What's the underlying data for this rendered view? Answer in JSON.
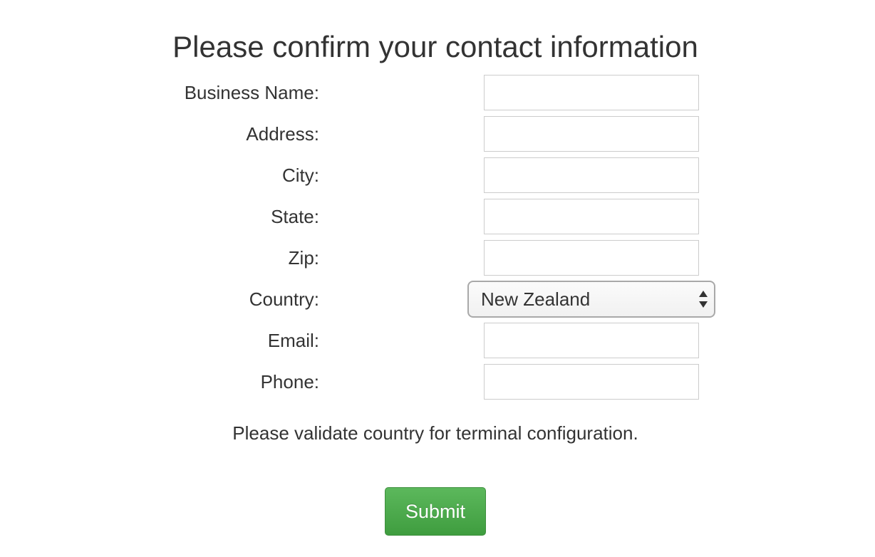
{
  "page": {
    "title": "Please confirm your contact information"
  },
  "form": {
    "fields": [
      {
        "label": "Business Name:",
        "value": "",
        "placeholder": ""
      },
      {
        "label": "Address:",
        "value": "",
        "placeholder": ""
      },
      {
        "label": "City:",
        "value": "",
        "placeholder": ""
      },
      {
        "label": "State:",
        "value": "",
        "placeholder": ""
      },
      {
        "label": "Zip:",
        "value": "",
        "placeholder": ""
      },
      {
        "label": "Country:",
        "selected": "New Zealand"
      },
      {
        "label": "Email:",
        "value": "",
        "placeholder": ""
      },
      {
        "label": "Phone:",
        "value": "",
        "placeholder": ""
      }
    ],
    "note": "Please validate country for terminal configuration.",
    "submit_label": "Submit",
    "icons": {
      "country_select": "up-down-arrows-icon"
    }
  },
  "colors": {
    "text": "#333333",
    "input_border": "#cccccc",
    "submit_green": "#4cae4c",
    "submit_text": "#ffffff"
  }
}
